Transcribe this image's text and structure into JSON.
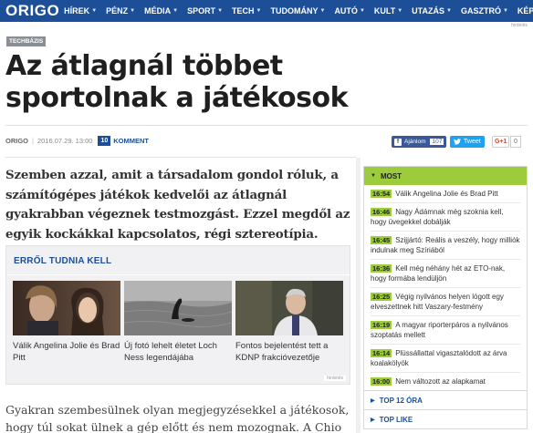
{
  "nav": {
    "logo": "ORIGO",
    "items": [
      "HÍREK",
      "PÉNZ",
      "MÉDIA",
      "SPORT",
      "TECH",
      "TUDOMÁNY",
      "AUTÓ",
      "KULT",
      "UTAZÁS",
      "GASZTRÓ",
      "KÉP"
    ],
    "ad_label": "hirdetés"
  },
  "article": {
    "tag": "TECHBÁZIS",
    "title": "Az átlagnál többet sportolnak a játékosok",
    "source": "ORIGO",
    "date": "2016.07.29. 13:00",
    "comment_count": "10",
    "comment_label": "KOMMENT",
    "lead": "Szemben azzal, amit a társadalom gondol róluk, a számítógépes játékok kedvelői az átlagnál gyakrabban végeznek testmozgást. Ezzel megdől az egyik kockákkal kapcsolatos, régi sztereotípia.",
    "body_start": "Gyakran szembesülnek olyan megjegyzésekkel a játékosok, hogy túl sokat ülnek a gép előtt és nem mozognak. A Chio Mozdulj"
  },
  "share": {
    "fb_label": "Ajánlom",
    "fb_count": "107",
    "tw_label": "Tweet",
    "gplus_label": "G+1",
    "gplus_count": "0"
  },
  "related": {
    "title": "ERRŐL TUDNIA KELL",
    "ad_label": "hirdetés",
    "cards": [
      {
        "caption": "Válik Angelina Jolie és Brad Pitt"
      },
      {
        "caption": "Új fotó lehelt életet Loch Ness legendájába"
      },
      {
        "caption": "Fontos bejelentést tett a KDNP frakcióvezetője"
      }
    ]
  },
  "sidebar": {
    "most_label": "MOST",
    "news": [
      {
        "time": "16:54",
        "text": "Válik Angelina Jolie és Brad Pitt"
      },
      {
        "time": "16:46",
        "text": "Nagy Ádámnak még szoknia kell, hogy üvegekkel dobálják"
      },
      {
        "time": "16:45",
        "text": "Szijjártó: Reális a veszély, hogy milliók indulnak meg Szíriából"
      },
      {
        "time": "16:36",
        "text": "Kell még néhány hét az ETO-nak, hogy formába lendüljön"
      },
      {
        "time": "16:25",
        "text": "Végig nyilvános helyen lógott egy elveszettnek hitt Vaszary-festmény"
      },
      {
        "time": "16:19",
        "text": "A magyar riporterpáros a nyilvános szoptatás mellett"
      },
      {
        "time": "16:14",
        "text": "Plüssállattal vigasztalódott az árva koalakölyök"
      },
      {
        "time": "16:00",
        "text": "Nem változott az alapkamat"
      }
    ],
    "top12_label": "TOP 12 ÓRA",
    "toplike_label": "TOP LIKE"
  },
  "colors": {
    "brand_blue": "#1d4f98",
    "accent_green": "#9ccb3b",
    "facebook": "#3b5998",
    "twitter": "#1da1f2"
  }
}
